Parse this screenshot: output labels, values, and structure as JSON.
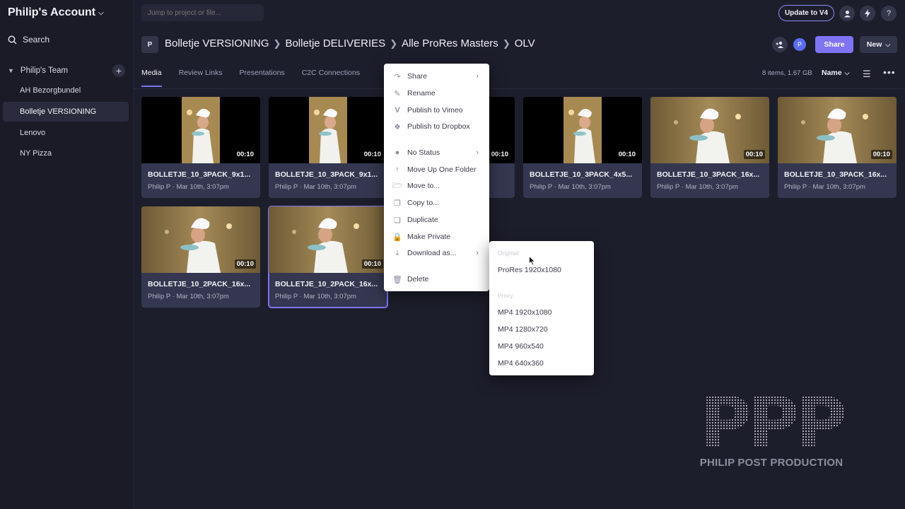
{
  "sidebar": {
    "account": "Philip's Account",
    "search": "Search",
    "team": "Philip's Team",
    "projects": [
      "AH Bezorgbundel",
      "Bolletje VERSIONING",
      "Lenovo",
      "NY Pizza"
    ]
  },
  "topbar": {
    "jump_placeholder": "Jump to project or file...",
    "update": "Update to V4"
  },
  "project": {
    "badge": "P",
    "breadcrumbs": [
      "Bolletje VERSIONING",
      "Bolletje DELIVERIES",
      "Alle ProRes Masters",
      "OLV"
    ],
    "avatar": "P",
    "share": "Share",
    "new": "New"
  },
  "tabs": [
    "Media",
    "Review Links",
    "Presentations",
    "C2C Connections"
  ],
  "list_info": {
    "count": "8 items, 1.67 GB",
    "sort": "Name"
  },
  "cards": [
    {
      "title": "BOLLETJE_10_3PACK_9x1...",
      "meta": "Philip P · Mar 10th, 3:07pm",
      "duration": "00:10"
    },
    {
      "title": "BOLLETJE_10_3PACK_9x1...",
      "meta": "Philip P · Mar 10th, 3:07pm",
      "duration": "00:10"
    },
    {
      "title": "...5...",
      "meta": "",
      "duration": "00:10"
    },
    {
      "title": "BOLLETJE_10_3PACK_4x5...",
      "meta": "Philip P · Mar 10th, 3:07pm",
      "duration": "00:10"
    },
    {
      "title": "BOLLETJE_10_3PACK_16x...",
      "meta": "Philip P · Mar 10th, 3:07pm",
      "duration": "00:10"
    },
    {
      "title": "BOLLETJE_10_3PACK_16x...",
      "meta": "Philip P · Mar 10th, 3:07pm",
      "duration": "00:10"
    },
    {
      "title": "BOLLETJE_10_2PACK_16x...",
      "meta": "Philip P · Mar 10th, 3:07pm",
      "duration": "00:10"
    },
    {
      "title": "BOLLETJE_10_2PACK_16x...",
      "meta": "Philip P · Mar 10th, 3:07pm",
      "duration": "00:10"
    }
  ],
  "context_menu": {
    "items": [
      "Share",
      "Rename",
      "Publish to Vimeo",
      "Publish to Dropbox",
      "No Status",
      "Move Up One Folder",
      "Move to...",
      "Copy to...",
      "Duplicate",
      "Make Private",
      "Download as...",
      "Delete"
    ]
  },
  "download_submenu": {
    "original_header": "Original",
    "original_items": [
      "ProRes 1920x1080"
    ],
    "proxy_header": "Proxy",
    "proxy_items": [
      "MP4 1920x1080",
      "MP4 1280x720",
      "MP4 960x540",
      "MP4 640x360"
    ]
  },
  "watermark": {
    "letters": "PPP",
    "text": "PHILIP POST PRODUCTION"
  },
  "colors": {
    "accent": "#7d73f3",
    "background": "#1d1e2c",
    "card": "#34374f"
  }
}
